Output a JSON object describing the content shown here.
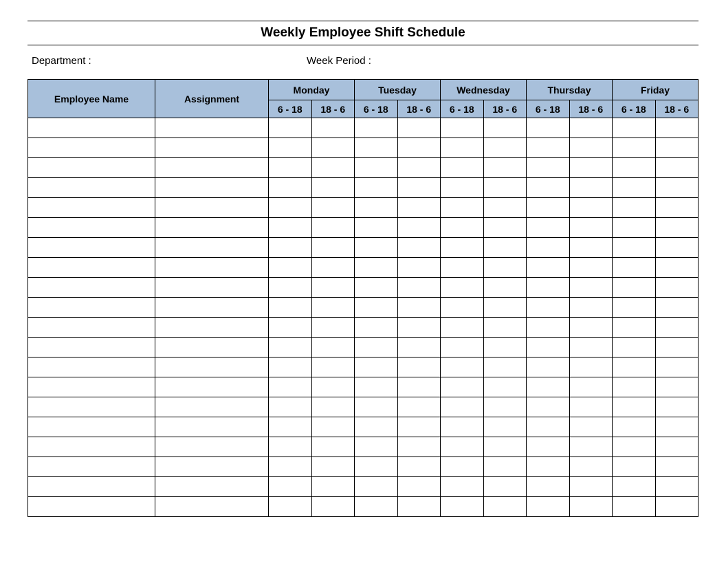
{
  "title": "Weekly Employee Shift Schedule",
  "labels": {
    "department": "Department :",
    "week_period": "Week  Period :",
    "employee_name": "Employee Name",
    "assignment": "Assignment"
  },
  "days": [
    {
      "name": "Monday",
      "shifts": [
        "6 - 18",
        "18 - 6"
      ]
    },
    {
      "name": "Tuesday",
      "shifts": [
        "6 - 18",
        "18 - 6"
      ]
    },
    {
      "name": "Wednesday",
      "shifts": [
        "6 - 18",
        "18 - 6"
      ]
    },
    {
      "name": "Thursday",
      "shifts": [
        "6 - 18",
        "18 - 6"
      ]
    },
    {
      "name": "Friday",
      "shifts": [
        "6 - 18",
        "18 - 6"
      ]
    }
  ],
  "rows": [
    {
      "name": "",
      "assignment": "",
      "cells": [
        "",
        "",
        "",
        "",
        "",
        "",
        "",
        "",
        "",
        ""
      ]
    },
    {
      "name": "",
      "assignment": "",
      "cells": [
        "",
        "",
        "",
        "",
        "",
        "",
        "",
        "",
        "",
        ""
      ]
    },
    {
      "name": "",
      "assignment": "",
      "cells": [
        "",
        "",
        "",
        "",
        "",
        "",
        "",
        "",
        "",
        ""
      ]
    },
    {
      "name": "",
      "assignment": "",
      "cells": [
        "",
        "",
        "",
        "",
        "",
        "",
        "",
        "",
        "",
        ""
      ]
    },
    {
      "name": "",
      "assignment": "",
      "cells": [
        "",
        "",
        "",
        "",
        "",
        "",
        "",
        "",
        "",
        ""
      ]
    },
    {
      "name": "",
      "assignment": "",
      "cells": [
        "",
        "",
        "",
        "",
        "",
        "",
        "",
        "",
        "",
        ""
      ]
    },
    {
      "name": "",
      "assignment": "",
      "cells": [
        "",
        "",
        "",
        "",
        "",
        "",
        "",
        "",
        "",
        ""
      ]
    },
    {
      "name": "",
      "assignment": "",
      "cells": [
        "",
        "",
        "",
        "",
        "",
        "",
        "",
        "",
        "",
        ""
      ]
    },
    {
      "name": "",
      "assignment": "",
      "cells": [
        "",
        "",
        "",
        "",
        "",
        "",
        "",
        "",
        "",
        ""
      ]
    },
    {
      "name": "",
      "assignment": "",
      "cells": [
        "",
        "",
        "",
        "",
        "",
        "",
        "",
        "",
        "",
        ""
      ]
    },
    {
      "name": "",
      "assignment": "",
      "cells": [
        "",
        "",
        "",
        "",
        "",
        "",
        "",
        "",
        "",
        ""
      ]
    },
    {
      "name": "",
      "assignment": "",
      "cells": [
        "",
        "",
        "",
        "",
        "",
        "",
        "",
        "",
        "",
        ""
      ]
    },
    {
      "name": "",
      "assignment": "",
      "cells": [
        "",
        "",
        "",
        "",
        "",
        "",
        "",
        "",
        "",
        ""
      ]
    },
    {
      "name": "",
      "assignment": "",
      "cells": [
        "",
        "",
        "",
        "",
        "",
        "",
        "",
        "",
        "",
        ""
      ]
    },
    {
      "name": "",
      "assignment": "",
      "cells": [
        "",
        "",
        "",
        "",
        "",
        "",
        "",
        "",
        "",
        ""
      ]
    },
    {
      "name": "",
      "assignment": "",
      "cells": [
        "",
        "",
        "",
        "",
        "",
        "",
        "",
        "",
        "",
        ""
      ]
    },
    {
      "name": "",
      "assignment": "",
      "cells": [
        "",
        "",
        "",
        "",
        "",
        "",
        "",
        "",
        "",
        ""
      ]
    },
    {
      "name": "",
      "assignment": "",
      "cells": [
        "",
        "",
        "",
        "",
        "",
        "",
        "",
        "",
        "",
        ""
      ]
    },
    {
      "name": "",
      "assignment": "",
      "cells": [
        "",
        "",
        "",
        "",
        "",
        "",
        "",
        "",
        "",
        ""
      ]
    },
    {
      "name": "",
      "assignment": "",
      "cells": [
        "",
        "",
        "",
        "",
        "",
        "",
        "",
        "",
        "",
        ""
      ]
    }
  ]
}
